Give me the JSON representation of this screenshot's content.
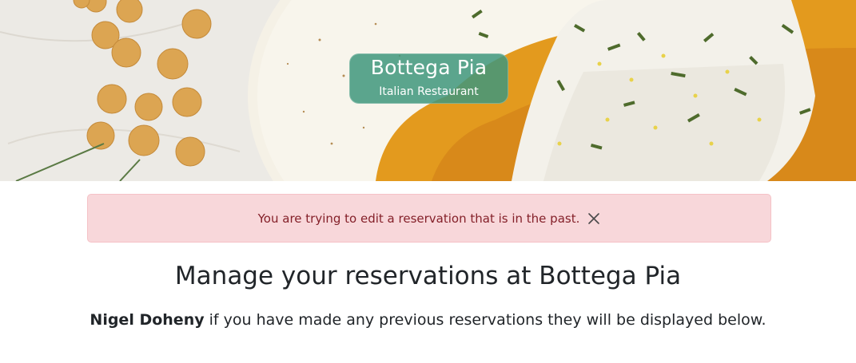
{
  "hero": {
    "brand_name": "Bottega Pia",
    "brand_subtitle": "Italian Restaurant",
    "image": "plated-fish-with-herbs-and-chickpeas"
  },
  "alert": {
    "message": "You are trying to edit a reservation that is in the past.",
    "close_icon": "close-icon",
    "colors": {
      "background": "#f8d7da",
      "text": "#842029"
    }
  },
  "main": {
    "title": "Manage your reservations at Bottega Pia",
    "user_name": "Nigel Doheny",
    "intro_text": " if you have made any previous reservations they will be displayed below."
  },
  "colors": {
    "accent": "#40967d"
  }
}
